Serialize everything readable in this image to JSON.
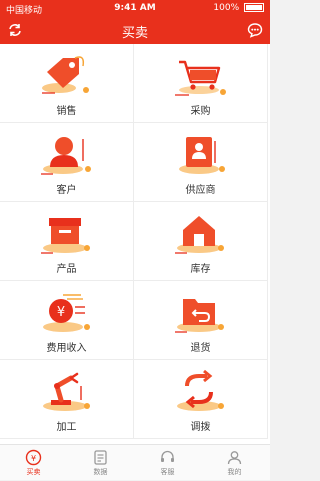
{
  "status": {
    "carrier": "中国移动",
    "time": "9:41 AM",
    "battery": "100%"
  },
  "header": {
    "title": "买卖"
  },
  "menu": [
    {
      "label": "销售",
      "icon": "tag-icon"
    },
    {
      "label": "采购",
      "icon": "cart-icon"
    },
    {
      "label": "客户",
      "icon": "user-icon"
    },
    {
      "label": "供应商",
      "icon": "supplier-icon"
    },
    {
      "label": "产品",
      "icon": "box-icon"
    },
    {
      "label": "库存",
      "icon": "warehouse-icon"
    },
    {
      "label": "费用收入",
      "icon": "yen-coin-icon"
    },
    {
      "label": "退货",
      "icon": "return-icon"
    },
    {
      "label": "加工",
      "icon": "robot-arm-icon"
    },
    {
      "label": "调拨",
      "icon": "transfer-icon"
    }
  ],
  "tabs": [
    {
      "label": "买卖",
      "icon": "trade-icon",
      "active": true
    },
    {
      "label": "数据",
      "icon": "data-icon",
      "active": false
    },
    {
      "label": "客服",
      "icon": "service-icon",
      "active": false
    },
    {
      "label": "我的",
      "icon": "profile-icon",
      "active": false
    }
  ],
  "colors": {
    "accent": "#e8301c",
    "orange": "#f7a536"
  }
}
